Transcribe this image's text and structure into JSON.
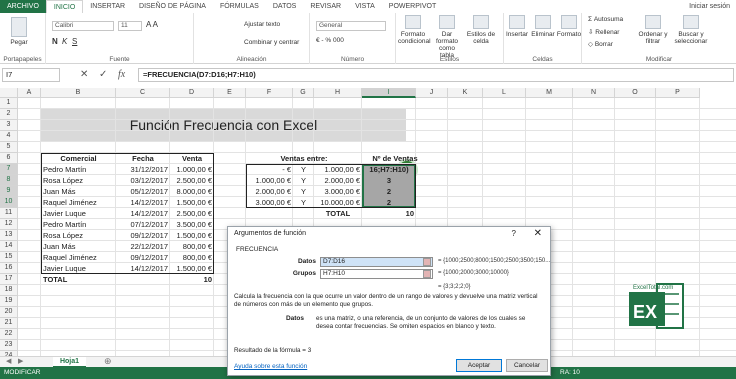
{
  "tabs": [
    "ARCHIVO",
    "INICIO",
    "INSERTAR",
    "DISEÑO DE PÁGINA",
    "FÓRMULAS",
    "DATOS",
    "REVISAR",
    "VISTA",
    "POWERPIVOT"
  ],
  "signin": "Iniciar sesión",
  "ribbon": {
    "paste": "Pegar",
    "clipboard": "Portapapeles",
    "font_name": "Calibri",
    "font_size": "11",
    "font_group": "Fuente",
    "wrap": "Ajustar texto",
    "merge": "Combinar y centrar",
    "align_group": "Alineación",
    "number_format": "General",
    "number_group": "Número",
    "cond_format": "Formato condicional",
    "format_table": "Dar formato como tabla",
    "cell_styles": "Estilos de celda",
    "styles_group": "Estilos",
    "insert": "Insertar",
    "delete": "Eliminar",
    "format": "Formato",
    "cells_group": "Celdas",
    "autosum": "Autosuma",
    "fill": "Rellenar",
    "clear": "Borrar",
    "sort": "Ordenar y filtrar",
    "find": "Buscar y seleccionar",
    "modify_group": "Modificar"
  },
  "formula_bar": {
    "name_box": "I7",
    "formula": "=FRECUENCIA(D7:D16;H7:H10)"
  },
  "columns": [
    "A",
    "B",
    "C",
    "D",
    "E",
    "F",
    "G",
    "H",
    "I",
    "J",
    "K",
    "L",
    "M",
    "N",
    "O",
    "P"
  ],
  "rows": [
    "1",
    "2",
    "3",
    "4",
    "5",
    "6",
    "7",
    "8",
    "9",
    "10",
    "11",
    "12",
    "13",
    "14",
    "15",
    "16",
    "17",
    "18",
    "19",
    "20",
    "21",
    "22",
    "23",
    "24"
  ],
  "sheet": {
    "title": "Función Frecuencia con Excel",
    "headers": {
      "comercial": "Comercial",
      "fecha": "Fecha",
      "venta": "Venta",
      "ventas_entre": "Ventas entre:",
      "n_ventas": "Nº de Ventas"
    },
    "sales": [
      [
        "Pedro Martín",
        "31/12/2017",
        "1.000,00 €"
      ],
      [
        "Rosa López",
        "03/12/2017",
        "2.500,00 €"
      ],
      [
        "Juan  Más",
        "05/12/2017",
        "8.000,00 €"
      ],
      [
        "Raquel Jiménez",
        "14/12/2017",
        "1.500,00 €"
      ],
      [
        "Javier Luque",
        "14/12/2017",
        "2.500,00 €"
      ],
      [
        "Pedro Martín",
        "07/12/2017",
        "3.500,00 €"
      ],
      [
        "Rosa López",
        "09/12/2017",
        "1.500,00 €"
      ],
      [
        "Juan  Más",
        "22/12/2017",
        "800,00 €"
      ],
      [
        "Raquel Jiménez",
        "09/12/2017",
        "800,00 €"
      ],
      [
        "Javier Luque",
        "14/12/2017",
        "1.500,00 €"
      ]
    ],
    "ranges": [
      [
        "-   €",
        "Y",
        "1.000,00 €",
        "16;H7:H10)"
      ],
      [
        "1.000,00 €",
        "Y",
        "2.000,00 €",
        "3"
      ],
      [
        "2.000,00 €",
        "Y",
        "3.000,00 €",
        "2"
      ],
      [
        "3.000,00 €",
        "Y",
        "10.000,00 €",
        "2"
      ]
    ],
    "total_label": "TOTAL",
    "total_left": "10",
    "total_right": "10",
    "badge": "3"
  },
  "sheet_tab": "Hoja1",
  "status": "MODIFICAR",
  "status_right": "RA: 10",
  "dialog": {
    "title": "Argumentos de función",
    "help": "?",
    "close": "✕",
    "function_name": "FRECUENCIA",
    "arg1_label": "Datos",
    "arg1_value": "D7:D16",
    "arg1_result": "= {1000;2500;8000;1500;2500;3500;150...",
    "arg2_label": "Grupos",
    "arg2_value": "H7:H10",
    "arg2_result": "= {1000;2000;3000;10000}",
    "result_preview": "= {3;3;2;2;0}",
    "description": "Calcula la frecuencia con la que ocurre un valor dentro de un rango de valores y devuelve una matriz vertical de números con más de un elemento que grupos.",
    "arg_desc_label": "Datos",
    "arg_desc": "es una matriz, o una referencia, de un conjunto de valores de los cuales se desea contar frecuencias. Se omiten espacios en blanco y texto.",
    "result_label": "Resultado de la fórmula =",
    "result_value": "3",
    "help_link": "Ayuda sobre esta función",
    "ok": "Aceptar",
    "cancel": "Cancelar"
  },
  "logo_text": "EXCel",
  "logo_site": "ExcelTotal.com",
  "colors": {
    "excel_green": "#217346",
    "badge_green": "#2e7d32",
    "title_gray": "#d9d9d9",
    "sel_gray": "#a6a6a6"
  }
}
